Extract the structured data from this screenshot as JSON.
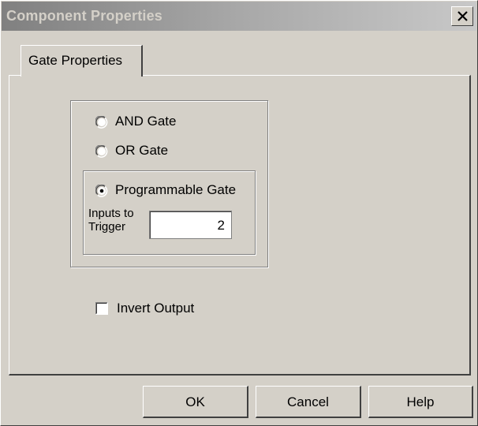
{
  "window": {
    "title": "Component Properties",
    "close_glyph": "×",
    "icons": {
      "close": "close-icon"
    }
  },
  "tabs": [
    {
      "label": "Gate Properties",
      "selected": true
    }
  ],
  "gate_type": {
    "options": [
      {
        "label": "AND Gate",
        "checked": false
      },
      {
        "label": "OR Gate",
        "checked": false
      },
      {
        "label": "Programmable Gate",
        "checked": true
      }
    ]
  },
  "programmable": {
    "inputs_label_line1": "Inputs to",
    "inputs_label_line2": "Trigger",
    "inputs_value": "2"
  },
  "invert_output": {
    "label": "Invert Output",
    "checked": false
  },
  "buttons": {
    "ok": "OK",
    "cancel": "Cancel",
    "help": "Help"
  },
  "colors": {
    "face": "#d4d0c8",
    "shadow": "#808080",
    "dark_shadow": "#404040",
    "highlight": "#ffffff",
    "title_gradient_start": "#808080",
    "title_gradient_end": "#c8c8c8"
  }
}
